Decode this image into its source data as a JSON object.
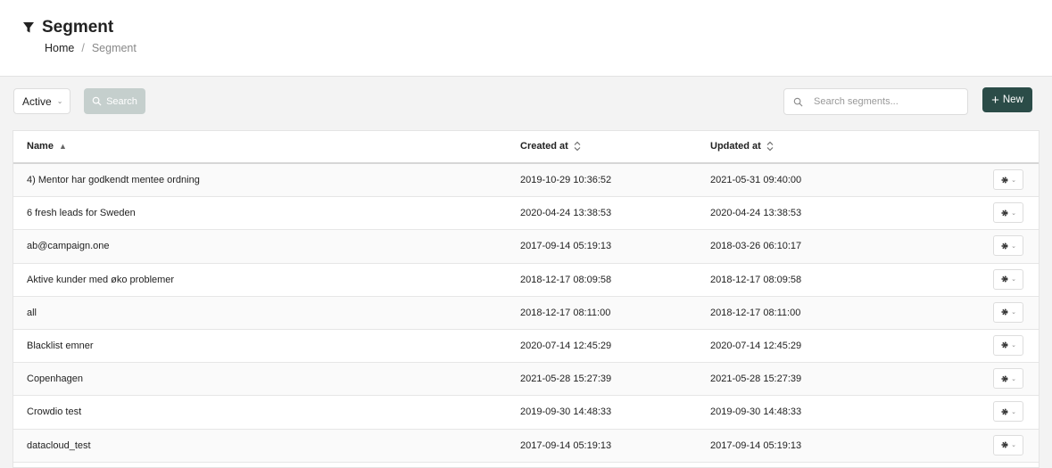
{
  "header": {
    "title": "Segment",
    "icon": "filter-icon",
    "breadcrumb": {
      "home": "Home",
      "separator": "/",
      "current": "Segment"
    }
  },
  "toolbar": {
    "status_select": {
      "value": "Active"
    },
    "search_button_label": "Search",
    "search_placeholder": "Search segments...",
    "new_button_label": "New"
  },
  "table": {
    "columns": {
      "name": "Name",
      "created": "Created at",
      "updated": "Updated at"
    },
    "rows": [
      {
        "name": "4) Mentor har godkendt mentee ordning",
        "created": "2019-10-29 10:36:52",
        "updated": "2021-05-31 09:40:00"
      },
      {
        "name": "6 fresh leads for Sweden",
        "created": "2020-04-24 13:38:53",
        "updated": "2020-04-24 13:38:53"
      },
      {
        "name": "ab@campaign.one",
        "created": "2017-09-14 05:19:13",
        "updated": "2018-03-26 06:10:17"
      },
      {
        "name": "Aktive kunder med øko problemer",
        "created": "2018-12-17 08:09:58",
        "updated": "2018-12-17 08:09:58"
      },
      {
        "name": "all",
        "created": "2018-12-17 08:11:00",
        "updated": "2018-12-17 08:11:00"
      },
      {
        "name": "Blacklist emner",
        "created": "2020-07-14 12:45:29",
        "updated": "2020-07-14 12:45:29"
      },
      {
        "name": "Copenhagen",
        "created": "2021-05-28 15:27:39",
        "updated": "2021-05-28 15:27:39"
      },
      {
        "name": "Crowdio test",
        "created": "2019-09-30 14:48:33",
        "updated": "2019-09-30 14:48:33"
      },
      {
        "name": "datacloud_test",
        "created": "2017-09-14 05:19:13",
        "updated": "2017-09-14 05:19:13"
      }
    ]
  },
  "colors": {
    "primary": "#2b4c48",
    "search_button": "#c5cfcd"
  }
}
